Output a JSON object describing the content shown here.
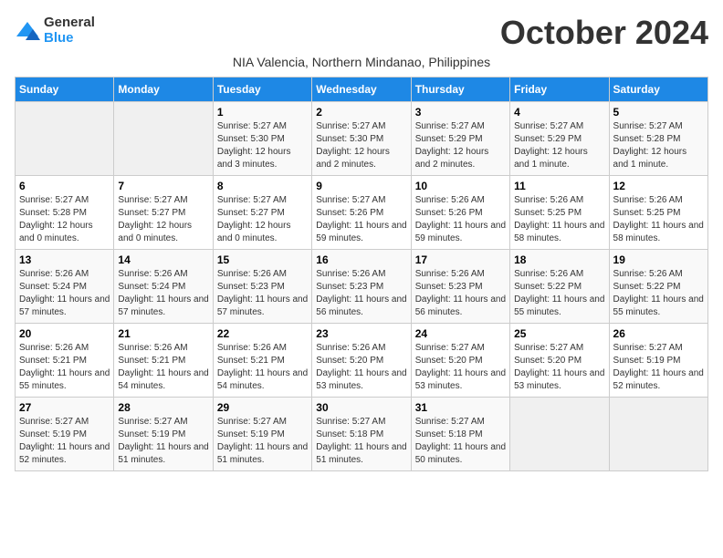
{
  "logo": {
    "line1": "General",
    "line2": "Blue"
  },
  "title": "October 2024",
  "location": "NIA Valencia, Northern Mindanao, Philippines",
  "days_of_week": [
    "Sunday",
    "Monday",
    "Tuesday",
    "Wednesday",
    "Thursday",
    "Friday",
    "Saturday"
  ],
  "weeks": [
    [
      {
        "day": "",
        "info": ""
      },
      {
        "day": "",
        "info": ""
      },
      {
        "day": "1",
        "info": "Sunrise: 5:27 AM\nSunset: 5:30 PM\nDaylight: 12 hours and 3 minutes."
      },
      {
        "day": "2",
        "info": "Sunrise: 5:27 AM\nSunset: 5:30 PM\nDaylight: 12 hours and 2 minutes."
      },
      {
        "day": "3",
        "info": "Sunrise: 5:27 AM\nSunset: 5:29 PM\nDaylight: 12 hours and 2 minutes."
      },
      {
        "day": "4",
        "info": "Sunrise: 5:27 AM\nSunset: 5:29 PM\nDaylight: 12 hours and 1 minute."
      },
      {
        "day": "5",
        "info": "Sunrise: 5:27 AM\nSunset: 5:28 PM\nDaylight: 12 hours and 1 minute."
      }
    ],
    [
      {
        "day": "6",
        "info": "Sunrise: 5:27 AM\nSunset: 5:28 PM\nDaylight: 12 hours and 0 minutes."
      },
      {
        "day": "7",
        "info": "Sunrise: 5:27 AM\nSunset: 5:27 PM\nDaylight: 12 hours and 0 minutes."
      },
      {
        "day": "8",
        "info": "Sunrise: 5:27 AM\nSunset: 5:27 PM\nDaylight: 12 hours and 0 minutes."
      },
      {
        "day": "9",
        "info": "Sunrise: 5:27 AM\nSunset: 5:26 PM\nDaylight: 11 hours and 59 minutes."
      },
      {
        "day": "10",
        "info": "Sunrise: 5:26 AM\nSunset: 5:26 PM\nDaylight: 11 hours and 59 minutes."
      },
      {
        "day": "11",
        "info": "Sunrise: 5:26 AM\nSunset: 5:25 PM\nDaylight: 11 hours and 58 minutes."
      },
      {
        "day": "12",
        "info": "Sunrise: 5:26 AM\nSunset: 5:25 PM\nDaylight: 11 hours and 58 minutes."
      }
    ],
    [
      {
        "day": "13",
        "info": "Sunrise: 5:26 AM\nSunset: 5:24 PM\nDaylight: 11 hours and 57 minutes."
      },
      {
        "day": "14",
        "info": "Sunrise: 5:26 AM\nSunset: 5:24 PM\nDaylight: 11 hours and 57 minutes."
      },
      {
        "day": "15",
        "info": "Sunrise: 5:26 AM\nSunset: 5:23 PM\nDaylight: 11 hours and 57 minutes."
      },
      {
        "day": "16",
        "info": "Sunrise: 5:26 AM\nSunset: 5:23 PM\nDaylight: 11 hours and 56 minutes."
      },
      {
        "day": "17",
        "info": "Sunrise: 5:26 AM\nSunset: 5:23 PM\nDaylight: 11 hours and 56 minutes."
      },
      {
        "day": "18",
        "info": "Sunrise: 5:26 AM\nSunset: 5:22 PM\nDaylight: 11 hours and 55 minutes."
      },
      {
        "day": "19",
        "info": "Sunrise: 5:26 AM\nSunset: 5:22 PM\nDaylight: 11 hours and 55 minutes."
      }
    ],
    [
      {
        "day": "20",
        "info": "Sunrise: 5:26 AM\nSunset: 5:21 PM\nDaylight: 11 hours and 55 minutes."
      },
      {
        "day": "21",
        "info": "Sunrise: 5:26 AM\nSunset: 5:21 PM\nDaylight: 11 hours and 54 minutes."
      },
      {
        "day": "22",
        "info": "Sunrise: 5:26 AM\nSunset: 5:21 PM\nDaylight: 11 hours and 54 minutes."
      },
      {
        "day": "23",
        "info": "Sunrise: 5:26 AM\nSunset: 5:20 PM\nDaylight: 11 hours and 53 minutes."
      },
      {
        "day": "24",
        "info": "Sunrise: 5:27 AM\nSunset: 5:20 PM\nDaylight: 11 hours and 53 minutes."
      },
      {
        "day": "25",
        "info": "Sunrise: 5:27 AM\nSunset: 5:20 PM\nDaylight: 11 hours and 53 minutes."
      },
      {
        "day": "26",
        "info": "Sunrise: 5:27 AM\nSunset: 5:19 PM\nDaylight: 11 hours and 52 minutes."
      }
    ],
    [
      {
        "day": "27",
        "info": "Sunrise: 5:27 AM\nSunset: 5:19 PM\nDaylight: 11 hours and 52 minutes."
      },
      {
        "day": "28",
        "info": "Sunrise: 5:27 AM\nSunset: 5:19 PM\nDaylight: 11 hours and 51 minutes."
      },
      {
        "day": "29",
        "info": "Sunrise: 5:27 AM\nSunset: 5:19 PM\nDaylight: 11 hours and 51 minutes."
      },
      {
        "day": "30",
        "info": "Sunrise: 5:27 AM\nSunset: 5:18 PM\nDaylight: 11 hours and 51 minutes."
      },
      {
        "day": "31",
        "info": "Sunrise: 5:27 AM\nSunset: 5:18 PM\nDaylight: 11 hours and 50 minutes."
      },
      {
        "day": "",
        "info": ""
      },
      {
        "day": "",
        "info": ""
      }
    ]
  ]
}
